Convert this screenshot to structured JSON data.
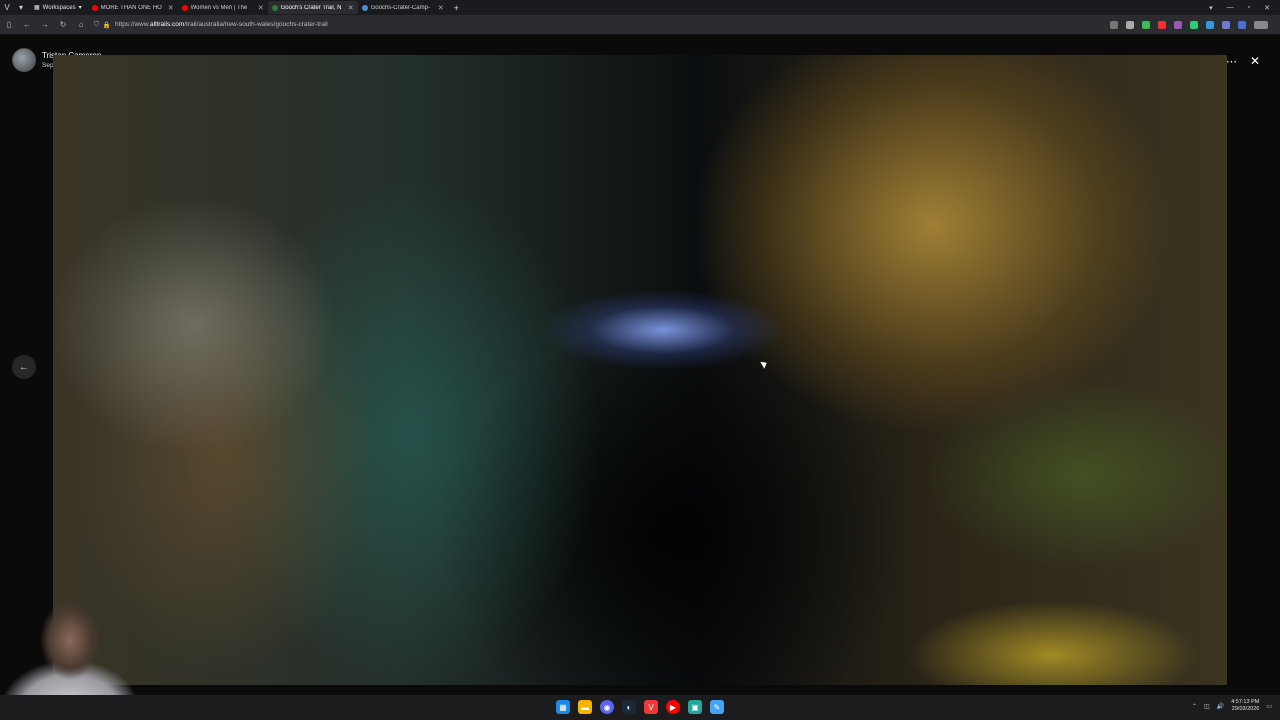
{
  "tabbar": {
    "workspaces_label": "Workspaces",
    "tabs": [
      {
        "label": "MORE THAN ONE HO",
        "color": "#ff0000",
        "active": false
      },
      {
        "label": "Women vs Men | The",
        "color": "#ff0000",
        "active": false
      },
      {
        "label": "Gooch's Crater Trail, N",
        "color": "#2e7d32",
        "active": true
      },
      {
        "label": "Goochs-Crater-Camp-",
        "color": "#4a90d9",
        "active": false
      }
    ]
  },
  "address": {
    "url_prefix": "https://www.",
    "url_domain": "alltrails.com",
    "url_path": "/trail/australia/new-south-wales/goochs-crater-trail"
  },
  "photo_viewer": {
    "author_name": "Tristan Cameron",
    "date": "Sep 23, 2024"
  },
  "taskbar": {
    "time": "4:57:13 PM",
    "date": "29/03/2026",
    "apps": [
      "windows-icon",
      "folder-icon",
      "discord-icon",
      "steam-icon",
      "vivaldi-icon",
      "youtube-icon",
      "app-icon",
      "app2-icon"
    ]
  }
}
